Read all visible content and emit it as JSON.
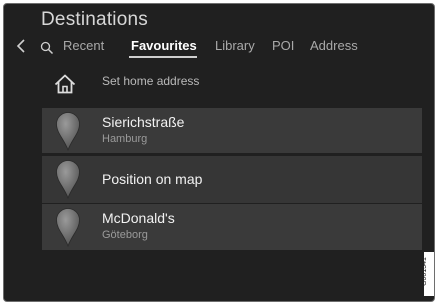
{
  "title": "Destinations",
  "tabs": [
    {
      "label": "Recent"
    },
    {
      "label": "Favourites",
      "active": true
    },
    {
      "label": "Library"
    },
    {
      "label": "POI"
    },
    {
      "label": "Address"
    }
  ],
  "home": {
    "label": "Set home address",
    "icon": "home-icon"
  },
  "favourites": [
    {
      "title": "Sierichstraße",
      "subtitle": "Hamburg",
      "icon": "map-pin-icon"
    },
    {
      "title": "Position on map",
      "icon": "map-pin-icon"
    },
    {
      "title": "McDonald's",
      "subtitle": "Göteborg",
      "icon": "map-pin-icon"
    }
  ],
  "image_code": "G061341",
  "colors": {
    "background": "#202020",
    "row": "#3a3a3a",
    "active_tab": "#ffffff",
    "inactive_tab": "#a9a9a9"
  }
}
